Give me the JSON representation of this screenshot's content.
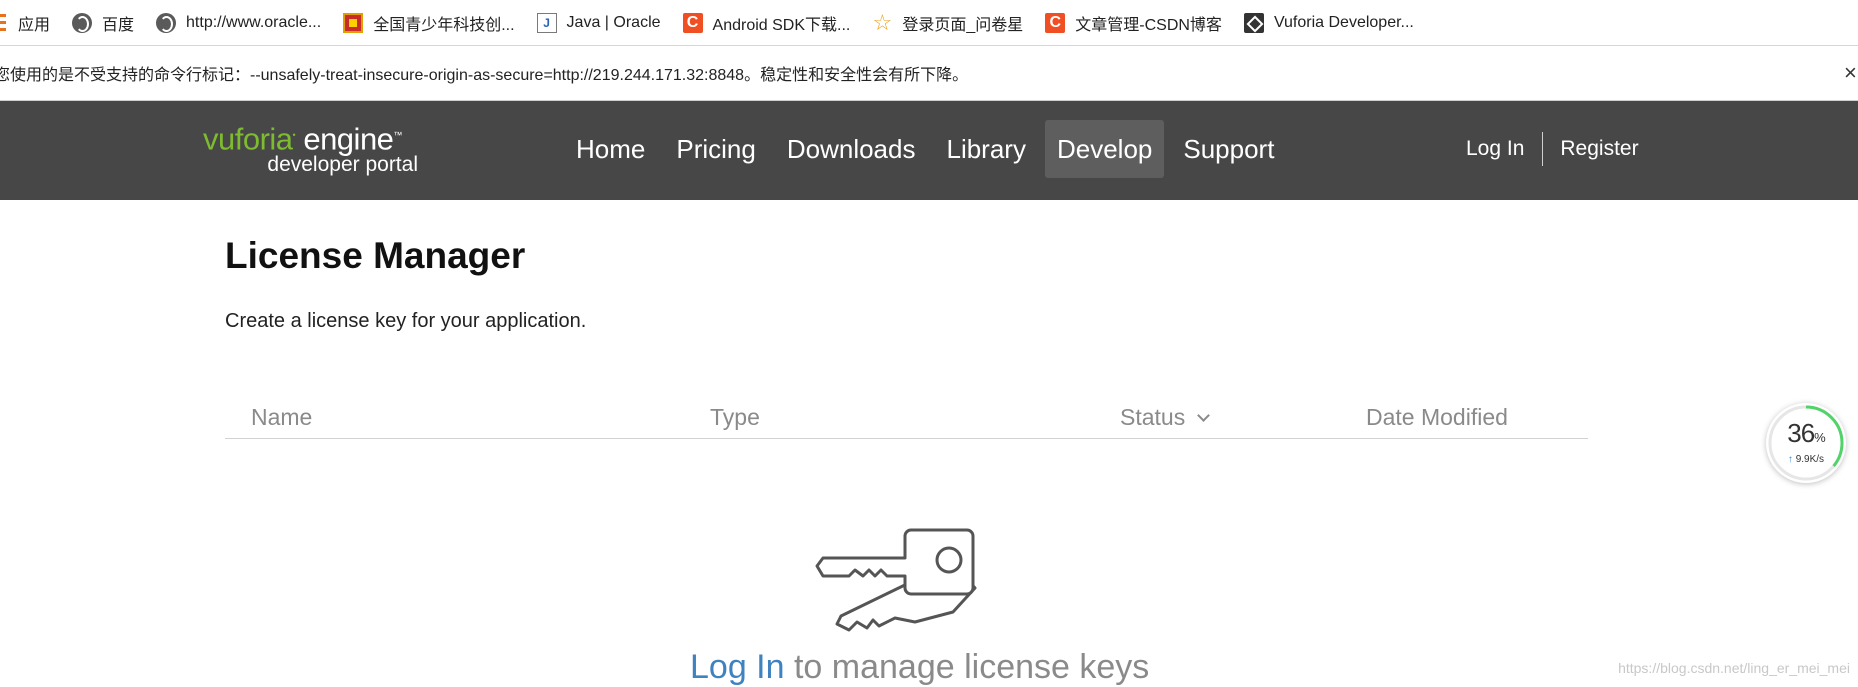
{
  "bookmarks": [
    {
      "label": "应用",
      "icon": "apps-grid-icon"
    },
    {
      "label": "百度",
      "icon": "globe-icon"
    },
    {
      "label": "http://www.oracle...",
      "icon": "globe-icon"
    },
    {
      "label": "全国青少年科技创...",
      "icon": "flag-icon"
    },
    {
      "label": "Java | Oracle",
      "icon": "java-icon"
    },
    {
      "label": "Android SDK下载...",
      "icon": "csdn-icon"
    },
    {
      "label": "登录页面_问卷星",
      "icon": "star-icon"
    },
    {
      "label": "文章管理-CSDN博客",
      "icon": "csdn-icon"
    },
    {
      "label": "Vuforia Developer...",
      "icon": "vuforia-icon"
    }
  ],
  "warning_bar": {
    "text": "您使用的是不受支持的命令行标记：--unsafely-treat-insecure-origin-as-secure=http://219.244.171.32:8848。稳定性和安全性会有所下降。",
    "close": "×"
  },
  "header": {
    "logo": {
      "brand": "vuforia",
      "product": "engine",
      "tm": "™",
      "sub": "developer portal"
    },
    "nav": [
      {
        "label": "Home",
        "active": false
      },
      {
        "label": "Pricing",
        "active": false
      },
      {
        "label": "Downloads",
        "active": false
      },
      {
        "label": "Library",
        "active": false
      },
      {
        "label": "Develop",
        "active": true
      },
      {
        "label": "Support",
        "active": false
      }
    ],
    "login": "Log In",
    "register": "Register"
  },
  "main": {
    "title": "License Manager",
    "description": "Create a license key for your application.",
    "table": {
      "columns": [
        "Name",
        "Type",
        "Status",
        "Date Modified"
      ]
    },
    "empty_state": {
      "link": "Log In",
      "text": " to manage license keys"
    }
  },
  "speed_widget": {
    "percent": "36",
    "unit": "%",
    "rate": "9.9K/s",
    "fill_fraction": 0.36
  },
  "watermark": "https://blog.csdn.net/ling_er_mei_mei",
  "colors": {
    "header_bg": "#474747",
    "brand_green": "#7dbb2f",
    "link_blue": "#3f82c0",
    "muted": "#8a8a8a"
  }
}
